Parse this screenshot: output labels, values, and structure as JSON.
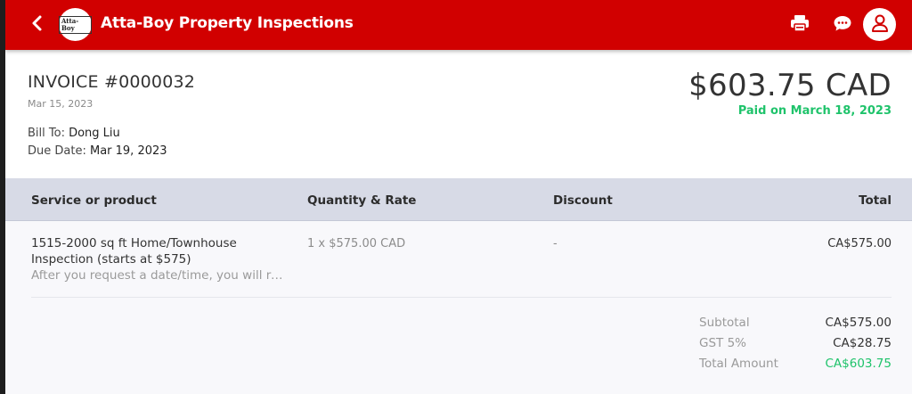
{
  "header": {
    "logo_text": "Atta-Boy",
    "title": "Atta-Boy Property Inspections",
    "icons": {
      "back": "back-arrow-icon",
      "print": "print-icon",
      "chat": "chat-icon",
      "profile": "user-icon"
    },
    "brand_color": "#d10000"
  },
  "invoice": {
    "title": "INVOICE #0000032",
    "date": "Mar 15, 2023",
    "bill_to_label": "Bill To:",
    "bill_to_value": "Dong Liu",
    "due_date_label": "Due Date:",
    "due_date_value": "Mar 19, 2023",
    "amount": "$603.75 CAD",
    "paid_status": "Paid on March 18, 2023",
    "paid_color": "#1fc36b"
  },
  "table": {
    "headers": {
      "service": "Service or product",
      "quantity": "Quantity & Rate",
      "discount": "Discount",
      "total": "Total"
    },
    "rows": [
      {
        "name": "1515-2000 sq ft Home/Townhouse Inspection (starts at $575)",
        "description": "After you request a date/time, you will receive a confirmation",
        "quantity_rate": "1 x $575.00 CAD",
        "discount": "-",
        "total": "CA$575.00"
      }
    ]
  },
  "summary": {
    "subtotal_label": "Subtotal",
    "subtotal_value": "CA$575.00",
    "tax_label": "GST 5%",
    "tax_value": "CA$28.75",
    "total_label": "Total Amount",
    "total_value": "CA$603.75"
  }
}
